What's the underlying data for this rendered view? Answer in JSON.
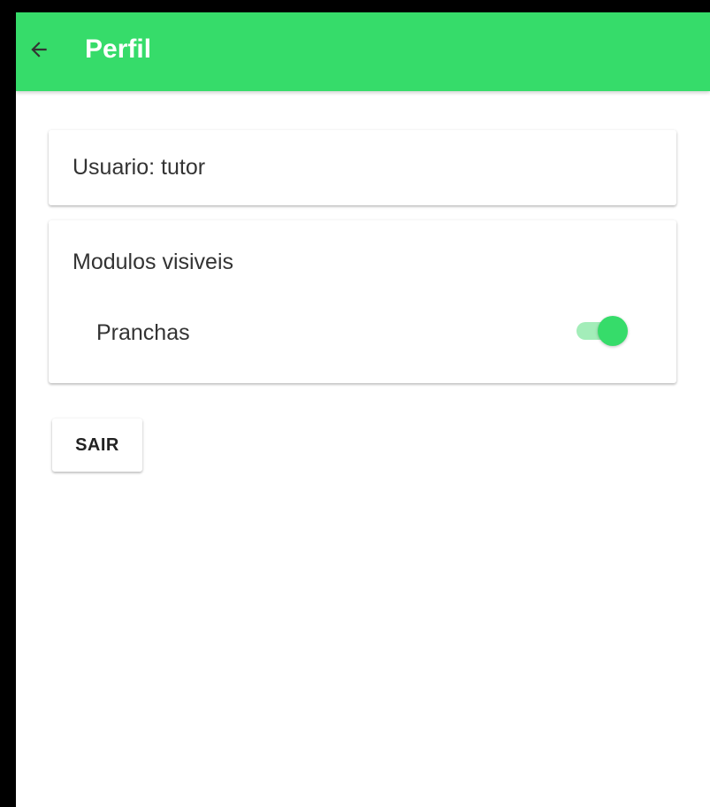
{
  "app_bar": {
    "back_icon": "arrow-left-icon",
    "title": "Perfil",
    "color": "#36dc6a",
    "title_color": "#ffffff"
  },
  "user_card": {
    "text": "Usuario: tutor"
  },
  "modules_card": {
    "title": "Modulos visiveis",
    "items": [
      {
        "label": "Pranchas",
        "enabled": true,
        "toggle_color": "#36dc6a"
      }
    ]
  },
  "logout_button": {
    "label": "SAIR"
  }
}
